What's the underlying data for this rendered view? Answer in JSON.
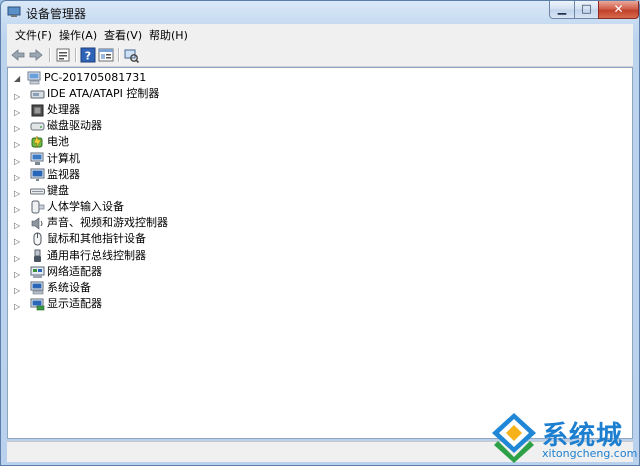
{
  "window": {
    "title": "设备管理器"
  },
  "menubar": {
    "items": [
      "文件(F)",
      "操作(A)",
      "查看(V)",
      "帮助(H)"
    ]
  },
  "toolbar": {
    "buttons": [
      "back-icon",
      "forward-icon",
      "properties-icon",
      "help-icon",
      "details-icon",
      "scan-icon"
    ]
  },
  "tree": {
    "root": "PC-201705081731",
    "nodes": [
      {
        "label": "IDE ATA/ATAPI 控制器",
        "icon": "ide-controller-icon"
      },
      {
        "label": "处理器",
        "icon": "processor-icon"
      },
      {
        "label": "磁盘驱动器",
        "icon": "disk-drive-icon"
      },
      {
        "label": "电池",
        "icon": "battery-icon"
      },
      {
        "label": "计算机",
        "icon": "computer-icon"
      },
      {
        "label": "监视器",
        "icon": "monitor-icon"
      },
      {
        "label": "键盘",
        "icon": "keyboard-icon"
      },
      {
        "label": "人体学输入设备",
        "icon": "hid-icon"
      },
      {
        "label": "声音、视频和游戏控制器",
        "icon": "sound-icon"
      },
      {
        "label": "鼠标和其他指针设备",
        "icon": "mouse-icon"
      },
      {
        "label": "通用串行总线控制器",
        "icon": "usb-icon"
      },
      {
        "label": "网络适配器",
        "icon": "network-adapter-icon"
      },
      {
        "label": "系统设备",
        "icon": "system-device-icon"
      },
      {
        "label": "显示适配器",
        "icon": "display-adapter-icon"
      }
    ]
  },
  "watermark": {
    "text": "系统城",
    "subtext": "xitongcheng.com"
  }
}
